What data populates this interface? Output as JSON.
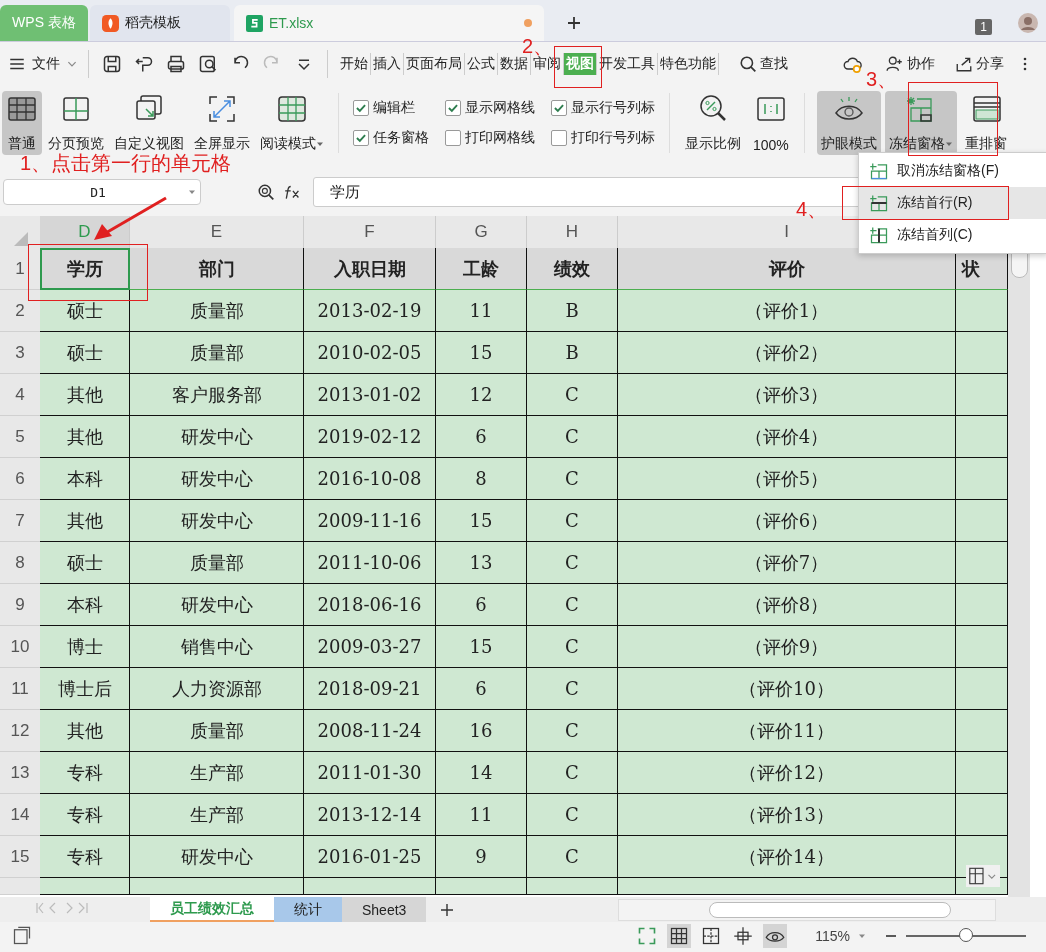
{
  "app_tab": "WPS 表格",
  "doc_tabs": [
    {
      "label": "稻壳模板",
      "kind": "template",
      "selected": false
    },
    {
      "label": "ET.xlsx",
      "kind": "sheet",
      "selected": true,
      "modified": true
    }
  ],
  "tab_count": "1",
  "menu": {
    "file": "文件",
    "tabs": [
      {
        "label": "开始",
        "selected": false
      },
      {
        "label": "插入",
        "selected": false
      },
      {
        "label": "页面布局",
        "selected": false
      },
      {
        "label": "公式",
        "selected": false
      },
      {
        "label": "数据",
        "selected": false
      },
      {
        "label": "审阅",
        "selected": false
      },
      {
        "label": "视图",
        "selected": true
      },
      {
        "label": "开发工具",
        "selected": false
      },
      {
        "label": "特色功能",
        "selected": false
      }
    ],
    "search": "查找",
    "collab": "协作",
    "share": "分享"
  },
  "ribbon": {
    "views": [
      {
        "label": "普通",
        "kind": "normal",
        "selected": true
      },
      {
        "label": "分页预览",
        "kind": "pagebreak",
        "selected": false
      },
      {
        "label": "自定义视图",
        "kind": "custom",
        "selected": false
      },
      {
        "label": "全屏显示",
        "kind": "fullscreen",
        "selected": false
      },
      {
        "label": "阅读模式",
        "kind": "reading",
        "selected": false,
        "dropdown": true
      }
    ],
    "checks": [
      {
        "label": "编辑栏",
        "checked": true
      },
      {
        "label": "任务窗格",
        "checked": true
      },
      {
        "label": "显示网格线",
        "checked": true
      },
      {
        "label": "打印网格线",
        "checked": false
      },
      {
        "label": "显示行号列标",
        "checked": true
      },
      {
        "label": "打印行号列标",
        "checked": false
      }
    ],
    "zoom": [
      {
        "label": "显示比例",
        "kind": "zoom"
      },
      {
        "label": "100%",
        "kind": "actual"
      }
    ],
    "tools": [
      {
        "label": "护眼模式",
        "kind": "eye",
        "selected": true,
        "dropdown": false
      },
      {
        "label": "冻结窗格",
        "kind": "freeze",
        "selected": true,
        "dropdown": true
      },
      {
        "label": "重排窗",
        "kind": "arrange",
        "selected": false,
        "dropdown": false
      }
    ]
  },
  "formula_bar": {
    "name_box": "D1",
    "value": "学历"
  },
  "columns": [
    {
      "label": "D",
      "selected": true
    },
    {
      "label": "E",
      "selected": false
    },
    {
      "label": "F",
      "selected": false
    },
    {
      "label": "G",
      "selected": false
    },
    {
      "label": "H",
      "selected": false
    },
    {
      "label": "I",
      "selected": false
    }
  ],
  "header_row": {
    "number": "1",
    "cells": [
      "学历",
      "部门",
      "入职日期",
      "工龄",
      "绩效",
      "评价",
      "状"
    ]
  },
  "rows": [
    {
      "number": "2",
      "cells": [
        "硕士",
        "质量部",
        "2013-02-19",
        "11",
        "B",
        "（评价1）"
      ]
    },
    {
      "number": "3",
      "cells": [
        "硕士",
        "质量部",
        "2010-02-05",
        "15",
        "B",
        "（评价2）"
      ]
    },
    {
      "number": "4",
      "cells": [
        "其他",
        "客户服务部",
        "2013-01-02",
        "12",
        "C",
        "（评价3）"
      ]
    },
    {
      "number": "5",
      "cells": [
        "其他",
        "研发中心",
        "2019-02-12",
        "6",
        "C",
        "（评价4）"
      ]
    },
    {
      "number": "6",
      "cells": [
        "本科",
        "研发中心",
        "2016-10-08",
        "8",
        "C",
        "（评价5）"
      ]
    },
    {
      "number": "7",
      "cells": [
        "其他",
        "研发中心",
        "2009-11-16",
        "15",
        "C",
        "（评价6）"
      ]
    },
    {
      "number": "8",
      "cells": [
        "硕士",
        "质量部",
        "2011-10-06",
        "13",
        "C",
        "（评价7）"
      ]
    },
    {
      "number": "9",
      "cells": [
        "本科",
        "研发中心",
        "2018-06-16",
        "6",
        "C",
        "（评价8）"
      ]
    },
    {
      "number": "10",
      "cells": [
        "博士",
        "销售中心",
        "2009-03-27",
        "15",
        "C",
        "（评价9）"
      ]
    },
    {
      "number": "11",
      "cells": [
        "博士后",
        "人力资源部",
        "2018-09-21",
        "6",
        "C",
        "（评价10）"
      ]
    },
    {
      "number": "12",
      "cells": [
        "其他",
        "质量部",
        "2008-11-24",
        "16",
        "C",
        "（评价11）"
      ]
    },
    {
      "number": "13",
      "cells": [
        "专科",
        "生产部",
        "2011-01-30",
        "14",
        "C",
        "（评价12）"
      ]
    },
    {
      "number": "14",
      "cells": [
        "专科",
        "生产部",
        "2013-12-14",
        "11",
        "C",
        "（评价13）"
      ]
    },
    {
      "number": "15",
      "cells": [
        "专科",
        "研发中心",
        "2016-01-25",
        "9",
        "C",
        "（评价14）"
      ]
    }
  ],
  "sheets": [
    {
      "label": "员工绩效汇总",
      "selected": true
    },
    {
      "label": "统计",
      "selected": false
    },
    {
      "label": "Sheet3",
      "selected": false
    }
  ],
  "status": {
    "zoom": "115%",
    "slider": {
      "level": 0.5
    }
  },
  "freeze_menu": [
    {
      "label": "取消冻结窗格(F)",
      "kind": "unfreeze",
      "selected": false
    },
    {
      "label": "冻结首行(R)",
      "kind": "row",
      "selected": true
    },
    {
      "label": "冻结首列(C)",
      "kind": "col",
      "selected": false
    }
  ],
  "annotations": [
    "1、点击第一行的单元格",
    "2、",
    "3、",
    "4、"
  ]
}
